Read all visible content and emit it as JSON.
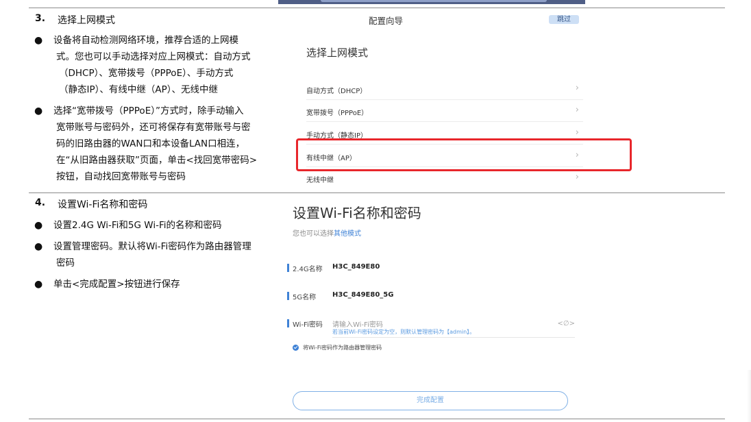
{
  "section3": {
    "number": "3.",
    "title": "选择上网模式",
    "bullets": [
      [
        "设备将自动检测网络环境，推荐合适的上网模",
        "式。您也可以手动选择对应上网模式：自动方式",
        "（DHCP）、宽带拨号（PPPoE）、手动方式",
        "（静态IP）、有线中继（AP）、无线中继"
      ],
      [
        "选择“宽带拨号（PPPoE）”方式时，除手动输入",
        "宽带账号与密码外，还可将保存有宽带账号与密",
        "码的旧路由器的WAN口和本设备LAN口相连，",
        "在“从旧路由器获取”页面，单击<找回宽带密码>",
        "按钮，自动找回宽带账号与密码"
      ]
    ]
  },
  "wizard": {
    "title": "配置向导",
    "skip": "跳过",
    "heading": "选择上网模式",
    "modes": [
      "自动方式（DHCP）",
      "宽带拨号（PPPoE）",
      "手动方式（静态IP）",
      "有线中继（AP）",
      "无线中继"
    ],
    "chevron": "›"
  },
  "section4": {
    "number": "4.",
    "title": "设置Wi-Fi名称和密码",
    "bullets": [
      [
        "设置2.4G Wi-Fi和5G Wi-Fi的名称和密码"
      ],
      [
        "设置管理密码。默认将Wi-Fi密码作为路由器管理",
        "密码"
      ],
      [
        "单击<完成配置>按钮进行保存"
      ]
    ]
  },
  "wifi": {
    "heading": "设置Wi-Fi名称和密码",
    "sub_prefix": "您也可以选择",
    "sub_link": "其他模式",
    "band24_label": "2.4G名称",
    "band24_value": "H3C_849E80",
    "band5_label": "5G名称",
    "band5_value": "H3C_849E80_5G",
    "pw_label": "Wi-Fi密码",
    "pw_placeholder": "请输入Wi-Fi密码",
    "pw_hint": "若当前Wi-Fi密码设定为空，则默认管理密码为【admin】。",
    "eye_icon": "<∅>",
    "checkbox_text": "将Wi-Fi密码作为路由器管理密码",
    "finish": "完成配置"
  },
  "bullet_char": "●",
  "colors": {
    "accent": "#3f82d6",
    "highlight": "#e8262b"
  }
}
